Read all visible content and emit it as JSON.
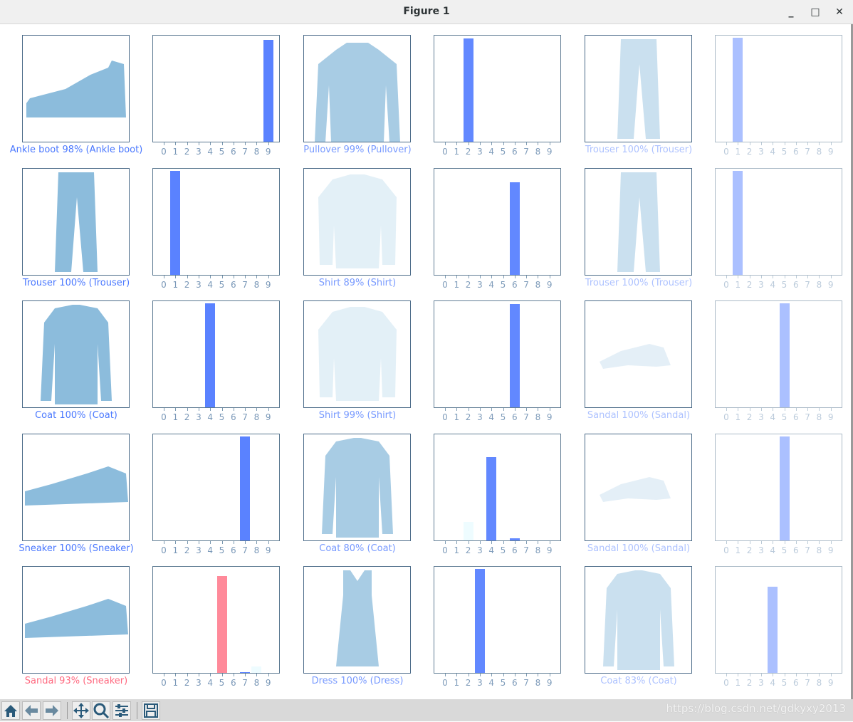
{
  "window": {
    "title": "Figure 1",
    "minimize": "_",
    "maximize": "□",
    "close": "✕"
  },
  "toolbar": {
    "buttons": [
      "home-icon",
      "back-icon",
      "forward-icon",
      "pan-icon",
      "zoom-icon",
      "configure-subplots-icon",
      "save-icon"
    ]
  },
  "watermark": "https://blog.csdn.net/gdkyxy2013",
  "colors": {
    "correct": "#5a82ff",
    "wrong": "#ff8a9a",
    "label_correct": "#4a78ff",
    "label_wrong": "#ff6a80"
  },
  "chart_data": {
    "type": "bar",
    "xticks": [
      "0",
      "1",
      "2",
      "3",
      "4",
      "5",
      "6",
      "7",
      "8",
      "9"
    ],
    "ylim": [
      0,
      1
    ],
    "plots": [
      {
        "label": "Ankle boot 98% (Ankle boot)",
        "kind": "boot",
        "correct": true,
        "probs": [
          0,
          0,
          0,
          0,
          0,
          0,
          0,
          0,
          0,
          0.98
        ]
      },
      {
        "label": "Pullover 99% (Pullover)",
        "kind": "pullover",
        "correct": true,
        "probs": [
          0,
          0,
          0.99,
          0,
          0,
          0,
          0,
          0,
          0,
          0
        ]
      },
      {
        "label": "Trouser 100% (Trouser)",
        "kind": "trouser",
        "correct": true,
        "probs": [
          0,
          1,
          0,
          0,
          0,
          0,
          0,
          0,
          0,
          0
        ]
      },
      {
        "label": "Trouser 100% (Trouser)",
        "kind": "trouser",
        "correct": true,
        "probs": [
          0,
          1,
          0,
          0,
          0,
          0,
          0,
          0,
          0,
          0
        ]
      },
      {
        "label": "Shirt 89% (Shirt)",
        "kind": "shirt",
        "correct": true,
        "probs": [
          0,
          0,
          0,
          0,
          0,
          0,
          0.89,
          0,
          0,
          0
        ]
      },
      {
        "label": "Trouser 100% (Trouser)",
        "kind": "trouser",
        "correct": true,
        "probs": [
          0,
          1,
          0,
          0,
          0,
          0,
          0,
          0,
          0,
          0
        ]
      },
      {
        "label": "Coat 100% (Coat)",
        "kind": "coat",
        "correct": true,
        "probs": [
          0,
          0,
          0,
          0,
          1,
          0,
          0,
          0,
          0,
          0
        ]
      },
      {
        "label": "Shirt 99% (Shirt)",
        "kind": "shirt",
        "correct": true,
        "probs": [
          0,
          0,
          0,
          0,
          0,
          0,
          0.99,
          0,
          0,
          0
        ]
      },
      {
        "label": "Sandal 100% (Sandal)",
        "kind": "sandal",
        "correct": true,
        "probs": [
          0,
          0,
          0,
          0,
          0,
          1,
          0,
          0,
          0,
          0
        ]
      },
      {
        "label": "Sneaker 100% (Sneaker)",
        "kind": "sneaker",
        "correct": true,
        "probs": [
          0,
          0,
          0,
          0,
          0,
          0,
          0,
          1,
          0,
          0
        ]
      },
      {
        "label": "Coat 80% (Coat)",
        "kind": "coat",
        "correct": true,
        "probs": [
          0,
          0,
          0.18,
          0,
          0.8,
          0,
          0.02,
          0,
          0,
          0
        ]
      },
      {
        "label": "Sandal 100% (Sandal)",
        "kind": "sandal",
        "correct": true,
        "probs": [
          0,
          0,
          0,
          0,
          0,
          1,
          0,
          0,
          0,
          0
        ]
      },
      {
        "label": "Sandal 93% (Sneaker)",
        "kind": "sneaker",
        "correct": false,
        "probs": [
          0,
          0,
          0,
          0,
          0,
          0.93,
          0,
          0.01,
          0.06,
          0
        ]
      },
      {
        "label": "Dress 100% (Dress)",
        "kind": "dress",
        "correct": true,
        "probs": [
          0,
          0,
          0,
          1,
          0,
          0,
          0,
          0,
          0,
          0
        ]
      },
      {
        "label": "Coat 83% (Coat)",
        "kind": "coat",
        "correct": true,
        "probs": [
          0,
          0,
          0,
          0,
          0.83,
          0,
          0,
          0,
          0,
          0
        ]
      }
    ]
  }
}
